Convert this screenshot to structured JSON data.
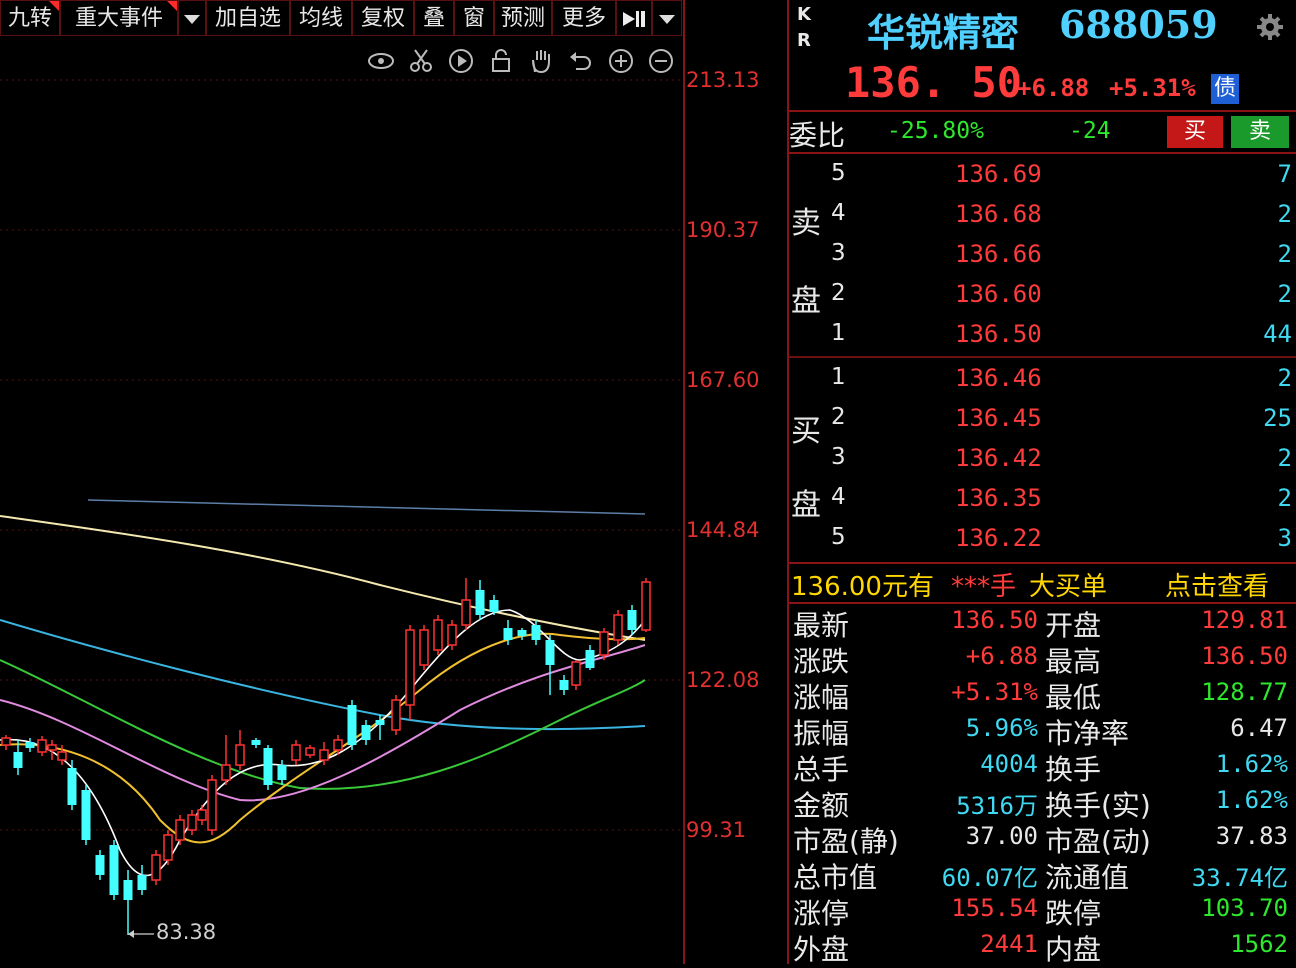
{
  "toolbar": {
    "items": [
      "九转",
      "重大事件",
      "",
      "加自选",
      "均线",
      "复权",
      "叠",
      "窗",
      "预测",
      "更多",
      "",
      ""
    ]
  },
  "chart": {
    "price_labels": [
      "213.13",
      "190.37",
      "167.60",
      "144.84",
      "122.08",
      "99.31"
    ],
    "low_marker": "83.38"
  },
  "quote": {
    "kr_top": "K",
    "kr_bottom": "R",
    "name": "华锐精密",
    "code": "688059",
    "price": "136. 50",
    "change": "+6.88",
    "change_pct": "+5.31%",
    "bond_badge": "债",
    "weibi_label": "委比",
    "weibi_pct": "-25.80%",
    "weibi_diff": "-24",
    "buy_label": "买",
    "sell_label": "卖"
  },
  "order_book": {
    "sell_label_1": "卖",
    "sell_label_2": "盘",
    "buy_label_1": "买",
    "buy_label_2": "盘",
    "asks": [
      {
        "level": "5",
        "price": "136.69",
        "vol": "7"
      },
      {
        "level": "4",
        "price": "136.68",
        "vol": "2"
      },
      {
        "level": "3",
        "price": "136.66",
        "vol": "2"
      },
      {
        "level": "2",
        "price": "136.60",
        "vol": "2"
      },
      {
        "level": "1",
        "price": "136.50",
        "vol": "44"
      }
    ],
    "bids": [
      {
        "level": "1",
        "price": "136.46",
        "vol": "2"
      },
      {
        "level": "2",
        "price": "136.45",
        "vol": "25"
      },
      {
        "level": "3",
        "price": "136.42",
        "vol": "2"
      },
      {
        "level": "4",
        "price": "136.35",
        "vol": "2"
      },
      {
        "level": "5",
        "price": "136.22",
        "vol": "3"
      }
    ]
  },
  "big_order": {
    "price_text": "136.00元有",
    "qty_text": "***手",
    "label": "大买单",
    "link": "点击查看"
  },
  "stats": [
    {
      "l": "最新",
      "lv": "136.50",
      "r": "开盘",
      "rv": "129.81"
    },
    {
      "l": "涨跌",
      "lv": "+6.88",
      "r": "最高",
      "rv": "136.50"
    },
    {
      "l": "涨幅",
      "lv": "+5.31%",
      "r": "最低",
      "rv": "128.77"
    },
    {
      "l": "振幅",
      "lv": "5.96%",
      "r": "市净率",
      "rv": "6.47"
    },
    {
      "l": "总手",
      "lv": "4004",
      "r": "换手",
      "rv": "1.62%"
    },
    {
      "l": "金额",
      "lv": "5316万",
      "r": "换手(实)",
      "rv": "1.62%"
    },
    {
      "l": "市盈(静)",
      "lv": "37.00",
      "r": "市盈(动)",
      "rv": "37.83"
    },
    {
      "l": "总市值",
      "lv": "60.07亿",
      "r": "流通值",
      "rv": "33.74亿"
    },
    {
      "l": "涨停",
      "lv": "155.54",
      "r": "跌停",
      "rv": "103.70"
    },
    {
      "l": "外盘",
      "lv": "2441",
      "r": "内盘",
      "rv": "1562"
    }
  ]
}
